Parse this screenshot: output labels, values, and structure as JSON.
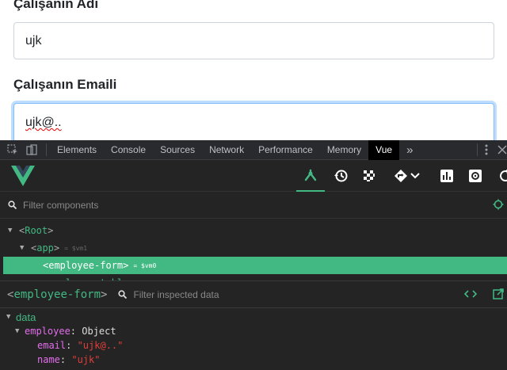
{
  "form": {
    "name_label": "Çalışanın Adı",
    "name_value": "ujk",
    "email_label": "Çalışanın Emaili",
    "email_value": "ujk@.."
  },
  "devtools": {
    "tabs": [
      "Elements",
      "Console",
      "Sources",
      "Network",
      "Performance",
      "Memory",
      "Vue"
    ],
    "active_tab": "Vue",
    "more_tabs": "»"
  },
  "vue": {
    "filter_components_placeholder": "Filter components",
    "tree": {
      "root": "Root",
      "app": "app",
      "app_vm": "= $vm1",
      "employee_form": "employee-form",
      "employee_form_vm": "= $vm0",
      "employee_table": "employee-table"
    },
    "inspector": {
      "component": "employee-form",
      "filter_placeholder": "Filter inspected data",
      "section": "data",
      "employee_key": "employee",
      "employee_type": "Object",
      "email_key": "email",
      "email_value": "\"ujk@..\"",
      "name_key": "name",
      "name_value": "\"ujk\""
    }
  },
  "colors": {
    "vue_green": "#42b983",
    "focus_border": "#80bdff",
    "devtools_bg": "#242424"
  }
}
